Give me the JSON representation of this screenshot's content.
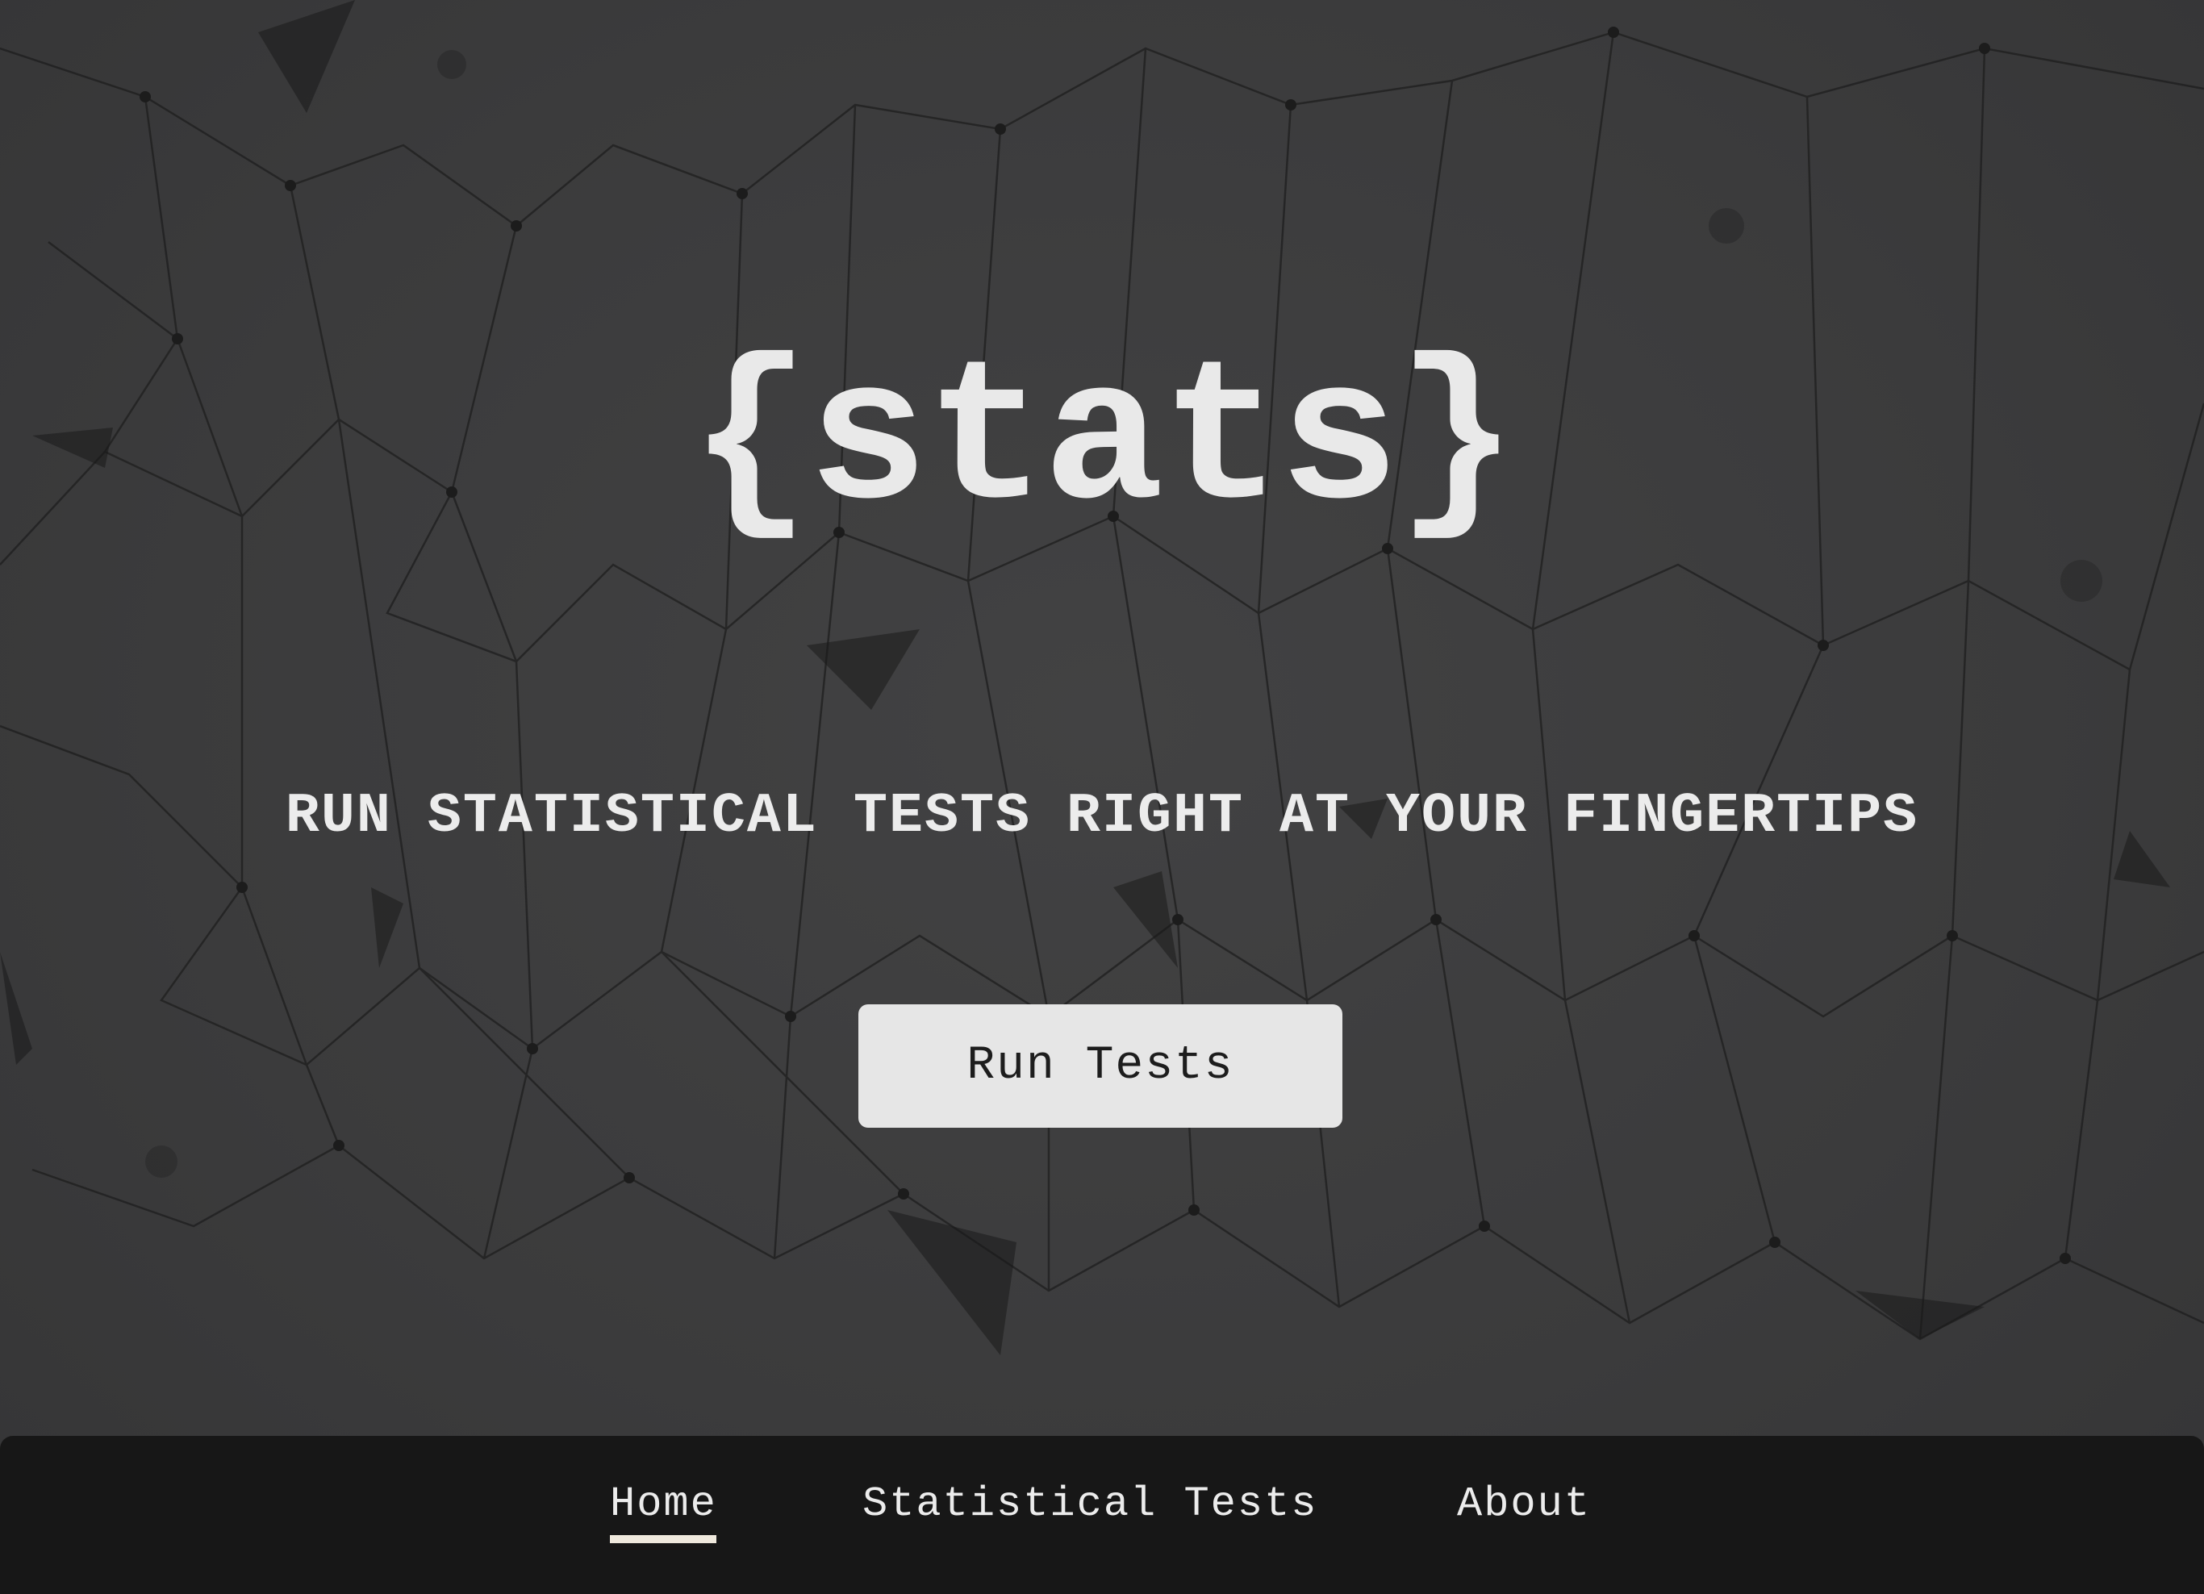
{
  "hero": {
    "title": "{stats}",
    "tagline": "RUN STATISTICAL TESTS RIGHT AT YOUR FINGERTIPS",
    "cta_label": "Run Tests"
  },
  "nav": {
    "items": [
      {
        "label": "Home",
        "active": true
      },
      {
        "label": "Statistical Tests",
        "active": false
      },
      {
        "label": "About",
        "active": false
      }
    ]
  },
  "colors": {
    "background": "#3c3c3d",
    "nav_background": "#171717",
    "button_background": "#e6e6e6",
    "text": "#ececec",
    "active_underline": "#efe9dd"
  }
}
